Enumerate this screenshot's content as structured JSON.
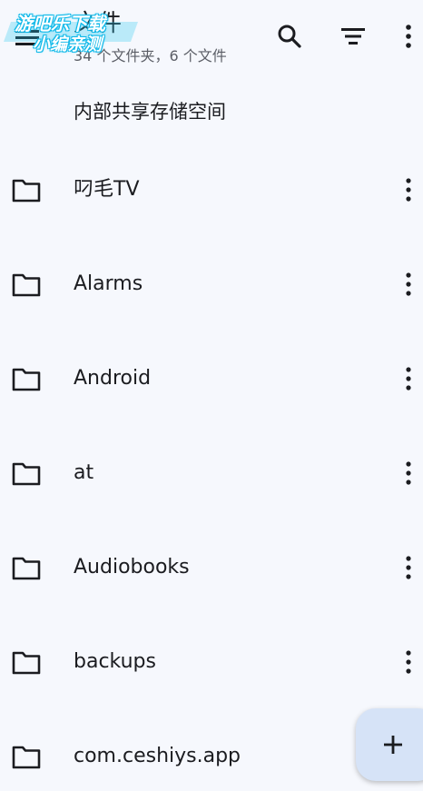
{
  "app_bar": {
    "title": "文件",
    "subtitle": "34 个文件夹，6 个文件",
    "menu_icon": "hamburger-menu-icon",
    "search_icon": "search-icon",
    "sort_icon": "sort-icon",
    "more_icon": "more-vert-icon"
  },
  "watermark": {
    "line1": "游吧乐下载",
    "line2": "小编亲测"
  },
  "storage_label": "内部共享存储空间",
  "folders": [
    {
      "name": "叼毛TV"
    },
    {
      "name": "Alarms"
    },
    {
      "name": "Android"
    },
    {
      "name": "at"
    },
    {
      "name": "Audiobooks"
    },
    {
      "name": "backups"
    },
    {
      "name": "com.ceshiys.app"
    }
  ],
  "fab": {
    "icon": "add-icon"
  },
  "colors": {
    "background": "#f6f8fd",
    "text": "#1b1c20",
    "secondary_text": "#5b5e66",
    "fab_background": "#d6e3f7",
    "watermark_accent": "#10b8e8"
  }
}
